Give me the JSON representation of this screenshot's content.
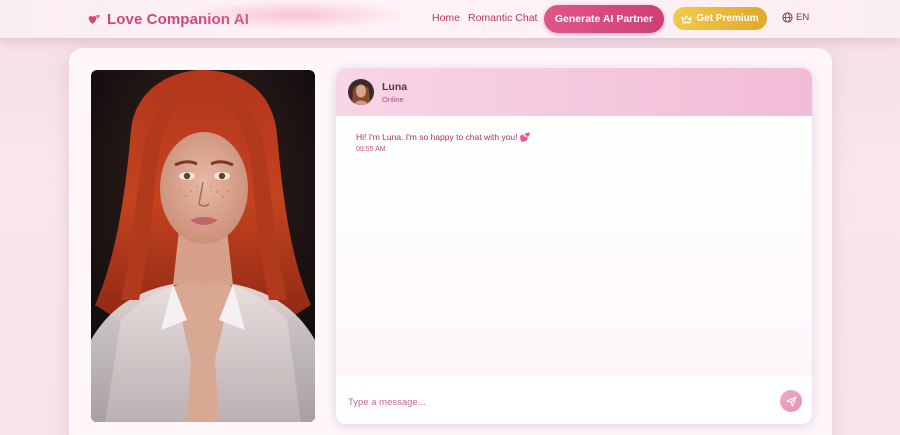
{
  "header": {
    "brand": "Love Companion AI",
    "nav": {
      "home": "Home",
      "romantic_chat": "Romantic Chat"
    },
    "generate_button": "Generate AI Partner",
    "premium_button": "Get Premium",
    "language": "EN"
  },
  "chat": {
    "partner_name": "Luna",
    "partner_status": "Online",
    "messages": [
      {
        "text": "Hi! I'm Luna. I'm so happy to chat with you! 💕",
        "time": "09:55 AM"
      }
    ],
    "input_placeholder": "Type a message..."
  },
  "colors": {
    "brand": "#d2467a",
    "generate_button": "#d9497f",
    "premium_button": "#e8b536",
    "chat_header": "#f4c6dc",
    "send_button": "#eb9dbd"
  },
  "icons": {
    "logo": "hearts-icon",
    "premium": "crown-icon",
    "language": "globe-icon",
    "send": "send-icon"
  }
}
